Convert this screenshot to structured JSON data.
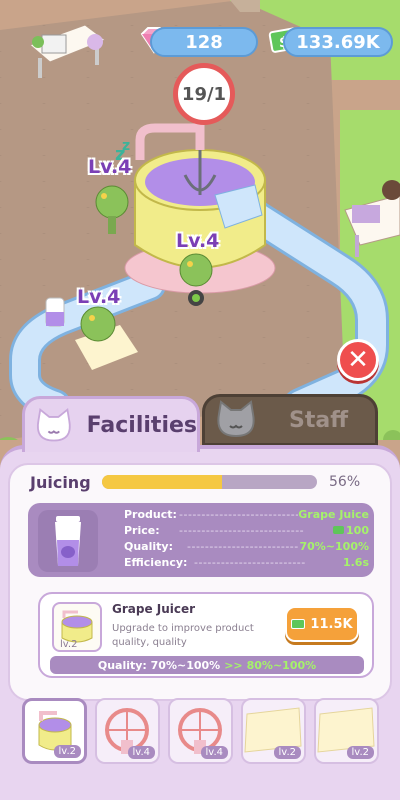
{
  "hud": {
    "gems": "128",
    "cash": "133.69K",
    "timer": "19/1",
    "timer_progress": 0.95
  },
  "scene": {
    "level_labels": [
      "Lv.4",
      "Lv.4",
      "Lv.4"
    ]
  },
  "tabs": {
    "facilities": "Facilities",
    "staff": "Staff"
  },
  "juicing": {
    "label": "Juicing",
    "percent_text": "56%",
    "progress": 0.56
  },
  "product_info": {
    "product_key": "Product:",
    "product_dots": "----------------------------",
    "product_value": "Grape Juice",
    "price_key": "Price:",
    "price_dots": "----------------------------",
    "price_value": "100",
    "quality_key": "Quality:",
    "quality_dots": "-------------------------",
    "quality_value": "70%~100%",
    "efficiency_key": "Efficiency:",
    "efficiency_dots": "-------------------------",
    "efficiency_value": "1.6s"
  },
  "juicer": {
    "name": "Grape Juicer",
    "description": "Upgrade to improve product quality, quality",
    "level": "lv.2",
    "upgrade_cost": "11.5K",
    "quality_label": "Quality: 70%~100%",
    "quality_arrow": ">>",
    "quality_new": "80%~100%"
  },
  "slots": [
    {
      "level": "lv.2",
      "icon": "juicer-icon"
    },
    {
      "level": "lv.4",
      "icon": "bike-icon"
    },
    {
      "level": "lv.4",
      "icon": "bike-icon"
    },
    {
      "level": "lv.2",
      "icon": "mat-icon"
    },
    {
      "level": "lv.2",
      "icon": "mat-icon"
    }
  ],
  "colors": {
    "accent_purple": "#a98bc0",
    "progress_yellow": "#f5c842",
    "cash_green": "#a5f26a",
    "close_red": "#ef4e4e"
  }
}
